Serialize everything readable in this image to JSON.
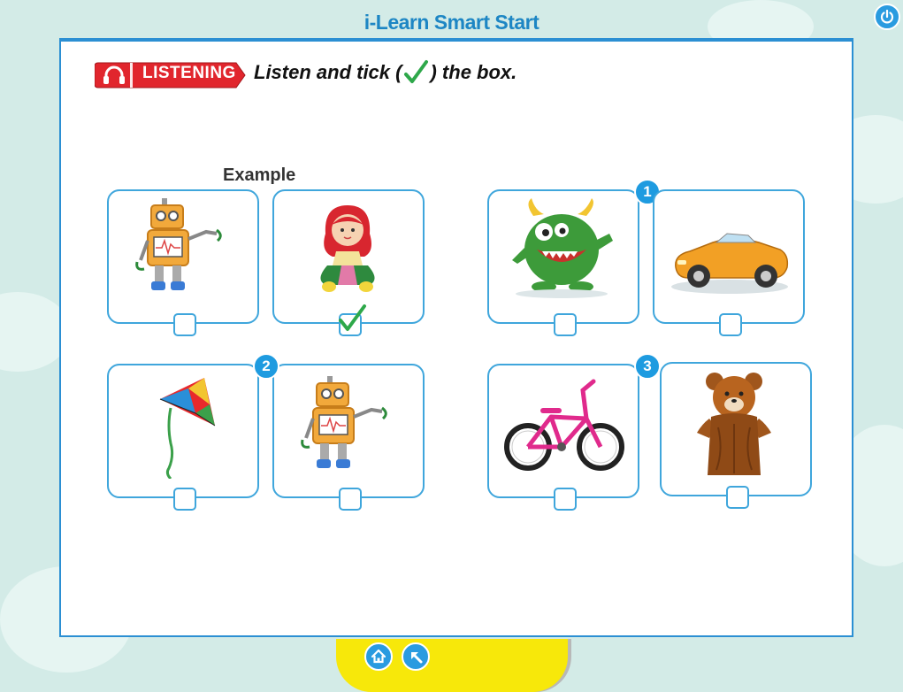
{
  "header": {
    "title": "i-Learn Smart Start"
  },
  "activity": {
    "section_badge": "LISTENING",
    "instruction_before": "Listen and tick (",
    "instruction_after": ") the box.",
    "example_label": "Example"
  },
  "questions": [
    {
      "number": "",
      "options": [
        "robot",
        "doll"
      ],
      "ticked": [
        false,
        true
      ]
    },
    {
      "number": "1",
      "options": [
        "monster",
        "car"
      ],
      "ticked": [
        false,
        false
      ]
    },
    {
      "number": "2",
      "options": [
        "kite",
        "robot"
      ],
      "ticked": [
        false,
        false
      ]
    },
    {
      "number": "3",
      "options": [
        "bike",
        "teddy bear"
      ],
      "ticked": [
        false,
        false
      ]
    }
  ],
  "icons": {
    "power": "power-icon",
    "home": "home-icon",
    "back": "back-arrow-icon",
    "badge": "headphones-icon",
    "tick": "tick-icon"
  },
  "colors": {
    "accent": "#2b8fd3",
    "badge_red": "#e1262d",
    "tick_green": "#2ea84a",
    "nav_yellow": "#f7e80a",
    "background": "#d3ebe7"
  }
}
